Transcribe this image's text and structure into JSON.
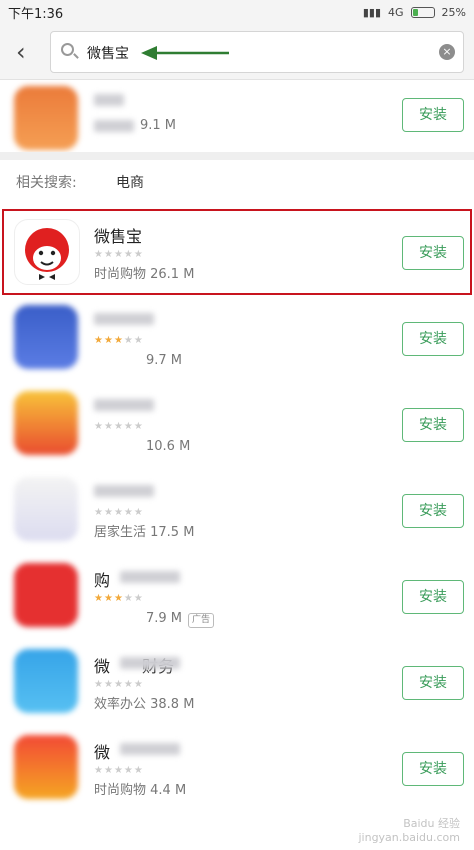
{
  "status_bar": {
    "time": "下午1:36",
    "network": "4G",
    "battery_percent": "25%",
    "battery_level": 0.25
  },
  "search": {
    "query": "微售宝"
  },
  "previous_result": {
    "meta": "9.1 M",
    "button_label": "安装"
  },
  "related_searches": {
    "label": "相关搜索:",
    "tags": [
      "电商"
    ]
  },
  "apps": [
    {
      "name": "微售宝",
      "category": "时尚购物",
      "size": "26.1 M",
      "rating": 0,
      "button_label": "安装",
      "highlighted": true,
      "icon": "monkey-logo-icon"
    },
    {
      "name": "",
      "category": "",
      "size": "9.7 M",
      "rating": 3,
      "button_label": "安装",
      "icon": "blue-app-icon"
    },
    {
      "name": "",
      "category": "",
      "size": "10.6 M",
      "rating": 0,
      "button_label": "安装",
      "icon": "red-yun-app-icon"
    },
    {
      "name": "",
      "category": "居家生活",
      "size": "17.5 M",
      "rating": 0,
      "button_label": "安装",
      "icon": "white-app-icon"
    },
    {
      "name": "购",
      "category": "",
      "size": "7.9 M",
      "rating": 3,
      "badge": "广告",
      "button_label": "安装",
      "icon": "red-shopping-app-icon"
    },
    {
      "name": "微",
      "name_suffix": "财务",
      "category": "效率办公",
      "size": "38.8 M",
      "rating": 0,
      "button_label": "安装",
      "icon": "blue-finance-app-icon"
    },
    {
      "name": "微",
      "category": "时尚购物",
      "size": "4.4 M",
      "rating": 0,
      "button_label": "安装",
      "icon": "orange-yun-app-icon"
    }
  ],
  "colors": {
    "accent_green": "#3a9c5a",
    "highlight_red": "#c8141e"
  },
  "watermark": {
    "line1": "Baidu 经验",
    "line2": "jingyan.baidu.com"
  }
}
